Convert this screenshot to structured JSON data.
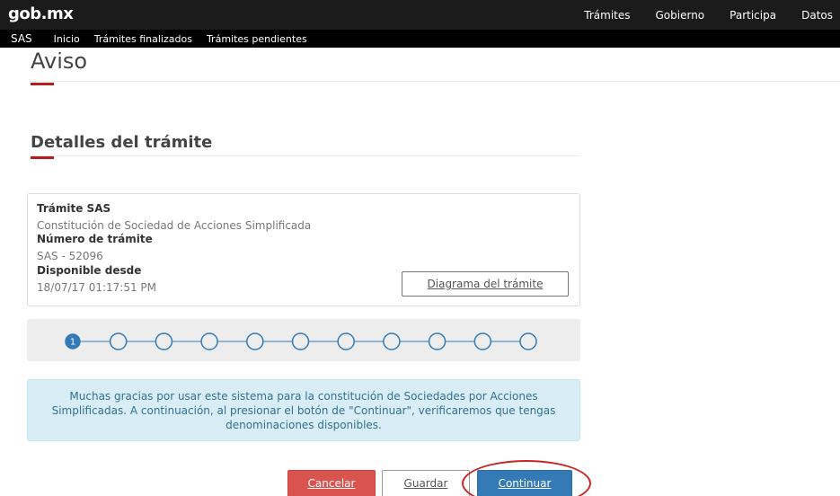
{
  "header": {
    "logo": "gob.mx",
    "nav": [
      "Trámites",
      "Gobierno",
      "Participa",
      "Datos"
    ]
  },
  "subnav": {
    "brand": "SAS",
    "items": [
      "Inicio",
      "Trámites finalizados",
      "Trámites pendientes"
    ]
  },
  "page": {
    "title": "Aviso",
    "section_title": "Detalles del trámite"
  },
  "details": {
    "tramite_label": "Trámite SAS",
    "tramite_value": "Constitución de Sociedad de Acciones Simplificada",
    "numero_label": "Número de trámite",
    "numero_value": "SAS - 52096",
    "disponible_label": "Disponible desde",
    "disponible_value": "18/07/17 01:17:51 PM",
    "diagram_button": "Diagrama del trámite"
  },
  "stepper": {
    "current_step": 1,
    "total_steps": 11,
    "current_label": "1",
    "active_color": "#337ab7"
  },
  "info_message": "Muchas gracias por usar este sistema para la constitución de Sociedades por Acciones Simplificadas. A continuación, al presionar el botón de \"Continuar\", verificaremos que tengas denominaciones disponibles.",
  "actions": {
    "cancel": "Cancelar",
    "save": "Guardar",
    "continue": "Continuar"
  },
  "colors": {
    "accent_red": "#b71c1c",
    "primary_blue": "#337ab7",
    "danger_red": "#d9534f",
    "info_bg": "#d9edf7"
  }
}
